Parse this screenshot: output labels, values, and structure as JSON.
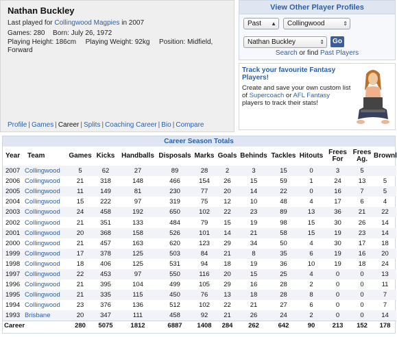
{
  "player": {
    "name": "Nathan Buckley",
    "last_played_prefix": "Last played for",
    "last_played_team": "Collingwood Magpies",
    "last_played_suffix": "in 2007",
    "games_label": "Games: 280",
    "born_label": "Born: July 26, 1972",
    "height_label": "Playing Height: 186cm",
    "weight_label": "Playing Weight: 92kg",
    "position_label_line1": "Position: Midfield,",
    "position_label_line2": "Forward"
  },
  "subnav": {
    "items": [
      "Profile",
      "Games",
      "Career",
      "Splits",
      "Coaching Career",
      "Bio",
      "Compare"
    ],
    "current": "Career",
    "separator": "|"
  },
  "profiles_box": {
    "title": "View Other Player Profiles",
    "status_select": "Past",
    "team_select": "Collingwood",
    "player_select": "Nathan Buckley",
    "go_label": "Go",
    "search_link": "Search",
    "or_find": "or find",
    "past_players_link": "Past Players"
  },
  "fantasy": {
    "title": "Track your favourite Fantasy Players!",
    "text_1": "Create and save your own custom list of",
    "supercoach": "Supercoach",
    "or": "or",
    "afl_fantasy": "AFL Fantasy",
    "text_2": "players to track their stats!"
  },
  "career": {
    "title": "Career Season Totals",
    "headers": [
      "Year",
      "Team",
      "Games",
      "Kicks",
      "Handballs",
      "Disposals",
      "Marks",
      "Goals",
      "Behinds",
      "Tackles",
      "Hitouts",
      "Frees For",
      "Frees Ag.",
      "Brownlow"
    ],
    "rows": [
      [
        "2007",
        "Collingwood",
        "5",
        "62",
        "27",
        "89",
        "28",
        "2",
        "3",
        "15",
        "0",
        "3",
        "5",
        ""
      ],
      [
        "2006",
        "Collingwood",
        "21",
        "318",
        "148",
        "466",
        "154",
        "26",
        "15",
        "59",
        "1",
        "24",
        "13",
        "5"
      ],
      [
        "2005",
        "Collingwood",
        "11",
        "149",
        "81",
        "230",
        "77",
        "20",
        "14",
        "22",
        "0",
        "16",
        "7",
        "5"
      ],
      [
        "2004",
        "Collingwood",
        "15",
        "222",
        "97",
        "319",
        "75",
        "12",
        "10",
        "48",
        "4",
        "17",
        "6",
        "4"
      ],
      [
        "2003",
        "Collingwood",
        "24",
        "458",
        "192",
        "650",
        "102",
        "22",
        "23",
        "89",
        "13",
        "36",
        "21",
        "22"
      ],
      [
        "2002",
        "Collingwood",
        "21",
        "351",
        "133",
        "484",
        "79",
        "15",
        "19",
        "98",
        "15",
        "30",
        "26",
        "14"
      ],
      [
        "2001",
        "Collingwood",
        "20",
        "368",
        "158",
        "526",
        "101",
        "14",
        "21",
        "58",
        "15",
        "19",
        "23",
        "14"
      ],
      [
        "2000",
        "Collingwood",
        "21",
        "457",
        "163",
        "620",
        "123",
        "29",
        "34",
        "50",
        "4",
        "30",
        "17",
        "18"
      ],
      [
        "1999",
        "Collingwood",
        "17",
        "378",
        "125",
        "503",
        "84",
        "21",
        "8",
        "35",
        "6",
        "19",
        "16",
        "20"
      ],
      [
        "1998",
        "Collingwood",
        "18",
        "406",
        "125",
        "531",
        "94",
        "18",
        "19",
        "36",
        "10",
        "19",
        "18",
        "24"
      ],
      [
        "1997",
        "Collingwood",
        "22",
        "453",
        "97",
        "550",
        "116",
        "20",
        "15",
        "25",
        "4",
        "0",
        "0",
        "13"
      ],
      [
        "1996",
        "Collingwood",
        "21",
        "395",
        "104",
        "499",
        "105",
        "29",
        "16",
        "28",
        "2",
        "0",
        "0",
        "11"
      ],
      [
        "1995",
        "Collingwood",
        "21",
        "335",
        "115",
        "450",
        "76",
        "13",
        "18",
        "28",
        "8",
        "0",
        "0",
        "7"
      ],
      [
        "1994",
        "Collingwood",
        "23",
        "376",
        "136",
        "512",
        "102",
        "22",
        "21",
        "27",
        "6",
        "0",
        "0",
        "7"
      ],
      [
        "1993",
        "Brisbane",
        "20",
        "347",
        "111",
        "458",
        "92",
        "21",
        "26",
        "24",
        "2",
        "0",
        "0",
        "14"
      ]
    ],
    "totals": [
      "Career",
      "",
      "280",
      "5075",
      "1812",
      "6887",
      "1408",
      "284",
      "262",
      "642",
      "90",
      "213",
      "152",
      "178"
    ]
  },
  "colors": {
    "link": "#2b5faa",
    "header_bg": "#dfe6f2",
    "stripe": "#f1f3f8",
    "go_button": "#3b5d98"
  }
}
